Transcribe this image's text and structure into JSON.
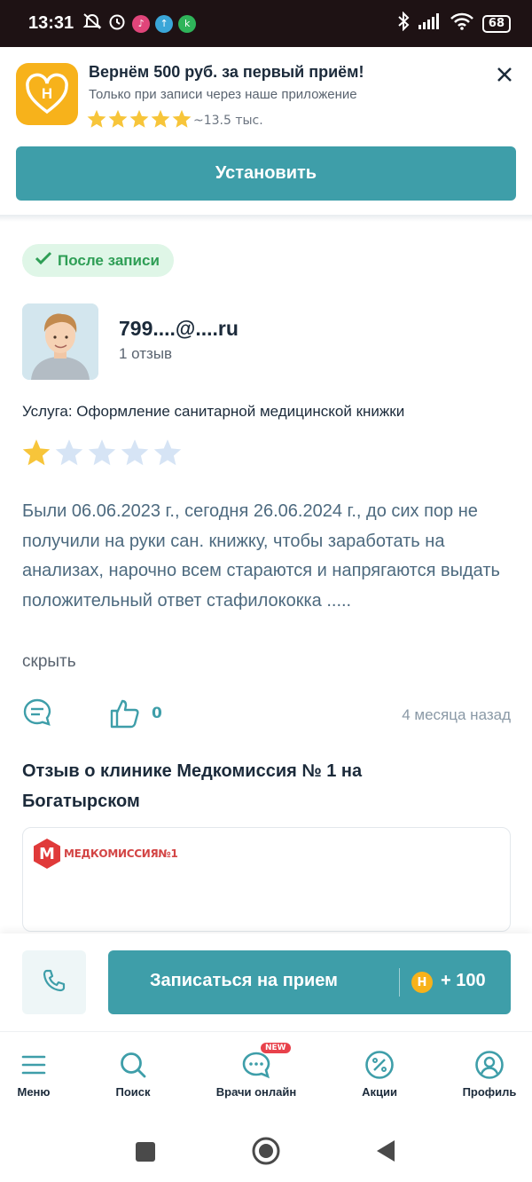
{
  "status_bar": {
    "time": "13:31",
    "battery": "68"
  },
  "banner": {
    "title": "Вернём 500 руб. за первый приём!",
    "subtitle": "Только при записи через наше приложение",
    "rating_count": "~13.5 тыс.",
    "stars": 5,
    "install_label": "Установить"
  },
  "review": {
    "tag": "После записи",
    "author": "799....@....ru",
    "author_reviews": "1 отзыв",
    "service": "Услуга: Оформление санитарной медицинской книжки",
    "rating": 1,
    "rating_max": 5,
    "text": "Были 06.06.2023 г., сегодня 26.06.2024 г., до сих пор не получили на руки сан. книжку, чтобы заработать на анализах, нарочно всем стараются и напрягаются выдать положительный ответ стафилококка .....",
    "hide_label": "скрыть",
    "likes": "0",
    "time_ago": "4 месяца назад"
  },
  "clinic": {
    "title": "Отзыв о клинике Медкомиссия № 1 на Богатырском",
    "logo_text": "МЕДКОМИССИЯ№1"
  },
  "bottom_actions": {
    "book_label": "Записаться на прием",
    "bonus": "+ 100"
  },
  "tabs": [
    {
      "label": "Меню",
      "icon": "menu-icon"
    },
    {
      "label": "Поиск",
      "icon": "search-icon"
    },
    {
      "label": "Врачи онлайн",
      "icon": "chat-icon",
      "badge": "NEW"
    },
    {
      "label": "Акции",
      "icon": "percent-icon"
    },
    {
      "label": "Профиль",
      "icon": "profile-icon"
    }
  ],
  "colors": {
    "accent": "#3e9ea9",
    "tag_green": "#2e9e55",
    "star": "#f7c53a",
    "star_empty": "#d6e4f5"
  }
}
